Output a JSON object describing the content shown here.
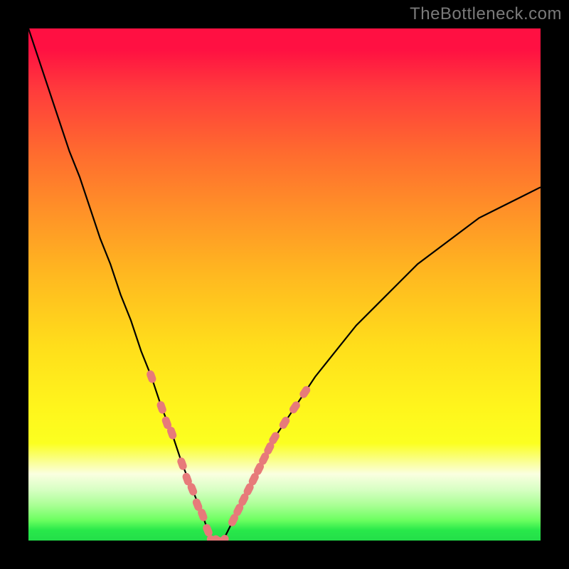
{
  "watermark": "TheBottleneck.com",
  "colors": {
    "frame_bg": "#000000",
    "curve": "#000000",
    "markers": "#e77a7a",
    "gradient_top": "#ff1042",
    "gradient_bottom": "#23de49"
  },
  "chart_data": {
    "type": "line",
    "title": "",
    "xlabel": "",
    "ylabel": "",
    "xlim": [
      0,
      100
    ],
    "ylim": [
      0,
      100
    ],
    "grid": false,
    "legend": false,
    "annotations": [
      "TheBottleneck.com"
    ],
    "series": [
      {
        "name": "bottleneck-curve",
        "x": [
          0,
          2,
          4,
          6,
          8,
          10,
          12,
          14,
          16,
          18,
          20,
          22,
          24,
          26,
          28,
          30,
          32,
          34,
          35,
          36,
          38,
          40,
          42,
          44,
          46,
          48,
          52,
          56,
          60,
          64,
          68,
          72,
          76,
          80,
          84,
          88,
          92,
          96,
          100
        ],
        "y": [
          100,
          94,
          88,
          82,
          76,
          71,
          65,
          59,
          54,
          48,
          43,
          37,
          32,
          26,
          21,
          15,
          10,
          5,
          2,
          0,
          0,
          4,
          8,
          12,
          16,
          20,
          26,
          32,
          37,
          42,
          46,
          50,
          54,
          57,
          60,
          63,
          65,
          67,
          69
        ]
      }
    ],
    "markers": {
      "name": "highlighted-points",
      "shape": "rounded-dash",
      "color": "#e77a7a",
      "points": [
        {
          "x": 24,
          "y": 32
        },
        {
          "x": 26,
          "y": 26
        },
        {
          "x": 27,
          "y": 23
        },
        {
          "x": 28,
          "y": 21
        },
        {
          "x": 30,
          "y": 15
        },
        {
          "x": 31,
          "y": 12
        },
        {
          "x": 32,
          "y": 10
        },
        {
          "x": 33,
          "y": 7
        },
        {
          "x": 34,
          "y": 5
        },
        {
          "x": 35,
          "y": 2
        },
        {
          "x": 36,
          "y": 0
        },
        {
          "x": 37,
          "y": 0
        },
        {
          "x": 38,
          "y": 0
        },
        {
          "x": 40,
          "y": 4
        },
        {
          "x": 41,
          "y": 6
        },
        {
          "x": 42,
          "y": 8
        },
        {
          "x": 43,
          "y": 10
        },
        {
          "x": 44,
          "y": 12
        },
        {
          "x": 45,
          "y": 14
        },
        {
          "x": 46,
          "y": 16
        },
        {
          "x": 47,
          "y": 18
        },
        {
          "x": 48,
          "y": 20
        },
        {
          "x": 50,
          "y": 23
        },
        {
          "x": 52,
          "y": 26
        },
        {
          "x": 54,
          "y": 29
        }
      ]
    }
  }
}
